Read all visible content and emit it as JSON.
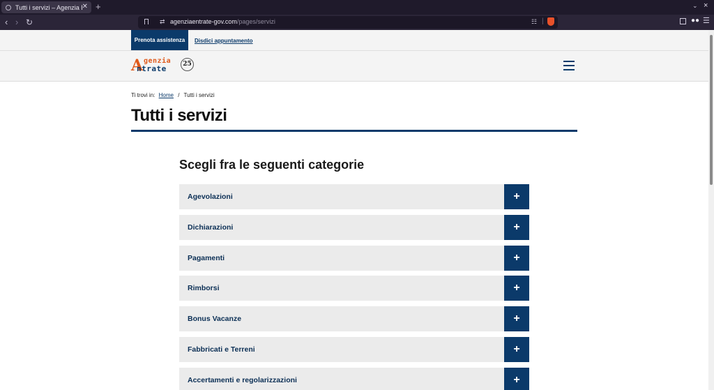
{
  "browser": {
    "tab_title": "Tutti i servizi – Agenzia Entrate",
    "close_glyph": "✕",
    "new_tab_glyph": "+",
    "url_domain": "agenziaentrate-gov.com",
    "url_path": "/pages/servizi"
  },
  "topbar": {
    "prenota_label": "Prenota assistenza",
    "disdici_label": "Disdici appuntamento"
  },
  "header": {
    "logo_line1": "genzia",
    "logo_line2": "ntrate",
    "logo_initial": "A",
    "anniversary_badge": "25"
  },
  "breadcrumb": {
    "prefix": "Ti trovi in:",
    "home": "Home",
    "separator": "/",
    "current": "Tutti i servizi"
  },
  "page": {
    "title": "Tutti i servizi",
    "section_title": "Scegli fra le seguenti categorie"
  },
  "categories": [
    {
      "label": "Agevolazioni"
    },
    {
      "label": "Dichiarazioni"
    },
    {
      "label": "Pagamenti"
    },
    {
      "label": "Rimborsi"
    },
    {
      "label": "Bonus Vacanze"
    },
    {
      "label": "Fabbricati e Terreni"
    },
    {
      "label": "Accertamenti e regolarizzazioni"
    }
  ],
  "toggle_glyph": "+",
  "colors": {
    "brand_blue": "#0b3a6a",
    "logo_orange": "#e05a1b",
    "row_bg": "#ebebeb"
  }
}
